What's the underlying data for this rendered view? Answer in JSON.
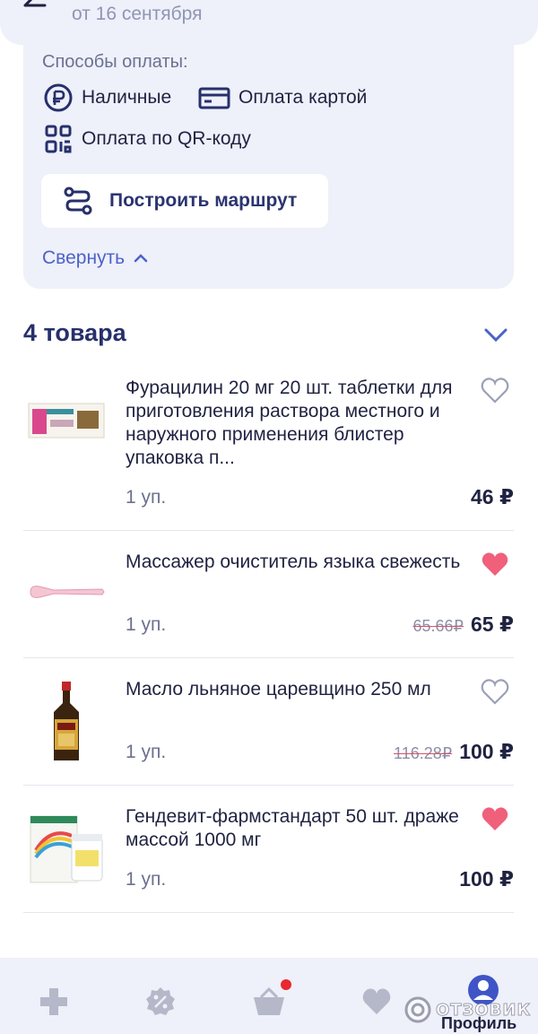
{
  "header": {
    "date_text": "от 16 сентября"
  },
  "store": {
    "payment_title": "Способы оплаты:",
    "payment_cash": "Наличные",
    "payment_card": "Оплата картой",
    "payment_qr": "Оплата по QR-коду",
    "route_button": "Построить маршрут",
    "collapse_link": "Свернуть"
  },
  "items_header": {
    "title": "4 товара"
  },
  "items": [
    {
      "title": "Фурацилин 20 мг 20 шт. таблетки для приготовления раствора местного и наружного применения блистер упаковка п...",
      "qty": "1 уп.",
      "old_price": "",
      "price": "46 ₽",
      "favorite": false
    },
    {
      "title": "Массажер очиститель языка свежесть",
      "qty": "1 уп.",
      "old_price": "65.66₽",
      "price": "65 ₽",
      "favorite": true
    },
    {
      "title": "Масло льняное царевщино 250 мл",
      "qty": "1 уп.",
      "old_price": "116.28₽",
      "price": "100 ₽",
      "favorite": false
    },
    {
      "title": "Гендевит-фармстандарт 50 шт. драже массой 1000 мг",
      "qty": "1 уп.",
      "old_price": "",
      "price": "100 ₽",
      "favorite": true
    }
  ],
  "bottom_nav": {
    "profile_label": "Профиль",
    "watermark": "ОТЗОВИК"
  },
  "colors": {
    "accent": "#27306b",
    "link": "#4d62c8",
    "heart_filled": "#f0607a",
    "badge": "#e8282e",
    "card_bg": "#eef0fa"
  }
}
